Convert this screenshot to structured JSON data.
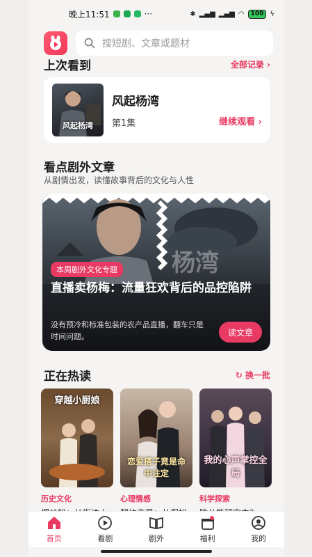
{
  "status_bar": {
    "time": "晚上11:51",
    "dots": "···",
    "battery": "100"
  },
  "search": {
    "placeholder": "搜短剧、文章或题材"
  },
  "last_watched": {
    "title": "上次看到",
    "all_records": "全部记录 ›",
    "show_title": "风起杨湾",
    "poster_text": "风起杨湾",
    "episode": "第1集",
    "continue": "继续观看 ›"
  },
  "articles": {
    "title": "看点剧外文章",
    "subtitle": "从剧情出发，读懂故事背后的文化与人性",
    "feature": {
      "badge": "本周剧外文化专题",
      "title": "直播卖杨梅：流量狂欢背后的品控陷阱",
      "description": "没有预冷和标准包装的农产品直播，翻车只是时间问题。",
      "read_button": "读文章",
      "overlay_text": "杨湾"
    }
  },
  "hot": {
    "title": "正在热读",
    "refresh": "换一批",
    "items": [
      {
        "poster_text": "穿越小厨娘",
        "category": "历史文化",
        "name": "爆炒粉：从街边小"
      },
      {
        "poster_text": "恋爱搭子竟是命中注定",
        "category": "心理情感",
        "name": "契约恋爱：从假扮"
      },
      {
        "poster_text": "我的心声掌控全局",
        "category": "科学探索",
        "name": "脑从能研究主？"
      }
    ]
  },
  "tabs": [
    {
      "label": "首页",
      "icon": "home-icon",
      "active": true
    },
    {
      "label": "看剧",
      "icon": "play-icon",
      "active": false
    },
    {
      "label": "剧外",
      "icon": "book-icon",
      "active": false
    },
    {
      "label": "福利",
      "icon": "gift-icon",
      "active": false
    },
    {
      "label": "我的",
      "icon": "profile-icon",
      "active": false
    }
  ],
  "colors": {
    "accent": "#e83a63",
    "background": "#f5f4f2"
  }
}
